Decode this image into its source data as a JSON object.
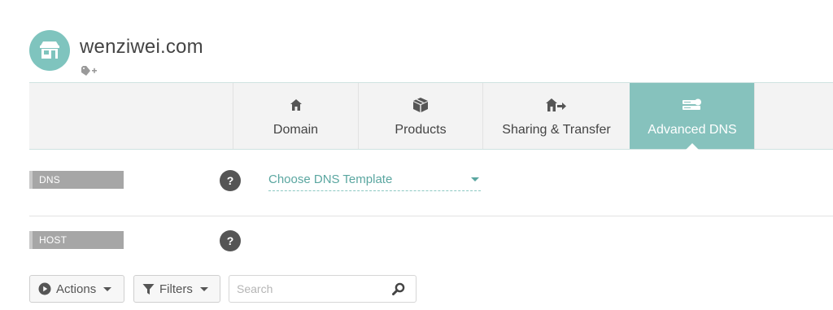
{
  "header": {
    "domain": "wenziwei.com",
    "avatar_icon": "storefront-icon",
    "tag_icon": "tag-add-icon"
  },
  "tabs": [
    {
      "label": "Domain",
      "icon": "home-icon",
      "active": false
    },
    {
      "label": "Products",
      "icon": "box-icon",
      "active": false
    },
    {
      "label": "Sharing & Transfer",
      "icon": "share-home-icon",
      "active": false
    },
    {
      "label": "Advanced DNS",
      "icon": "server-icon",
      "active": true
    }
  ],
  "dns_templates": {
    "label": "DNS TEMPLATES",
    "help": "?",
    "select_value": "Choose DNS Template"
  },
  "host_records": {
    "label": "HOST RECORDS",
    "help": "?"
  },
  "toolbar": {
    "actions_label": "Actions",
    "filters_label": "Filters",
    "search_placeholder": "Search"
  },
  "colors": {
    "accent": "#86c2bd",
    "avatar": "#7fc4be",
    "label_bg": "#a6a6a6",
    "link": "#5aa6a0"
  }
}
